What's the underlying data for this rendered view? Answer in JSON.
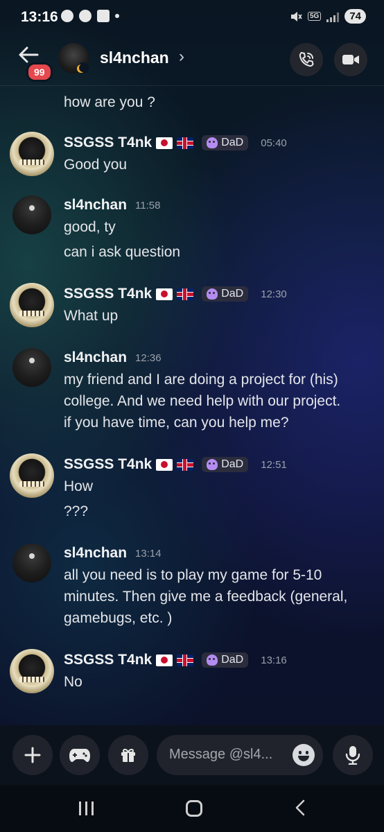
{
  "status_bar": {
    "time": "13:16",
    "network": "5G",
    "battery": "74"
  },
  "header": {
    "unread_count": "99",
    "channel_name": "sl4nchan",
    "chevron": "›"
  },
  "messages": [
    {
      "id": "m0",
      "author": null,
      "lines": [
        "how are you ?"
      ]
    },
    {
      "id": "m1",
      "author": "SSGSS T4nk",
      "tag": "DaD",
      "time": "05:40",
      "lines": [
        "Good you"
      ]
    },
    {
      "id": "m2",
      "author": "sl4nchan",
      "time": "11:58",
      "lines": [
        "good, ty",
        "can i ask question"
      ]
    },
    {
      "id": "m3",
      "author": "SSGSS T4nk",
      "tag": "DaD",
      "time": "12:30",
      "lines": [
        "What up"
      ]
    },
    {
      "id": "m4",
      "author": "sl4nchan",
      "time": "12:36",
      "lines": [
        "my friend and I are doing a project for (his)",
        "college. And we need help with our project.",
        "if you have time, can you help me?"
      ]
    },
    {
      "id": "m5",
      "author": "SSGSS T4nk",
      "tag": "DaD",
      "time": "12:51",
      "lines": [
        "How",
        "???"
      ]
    },
    {
      "id": "m6",
      "author": "sl4nchan",
      "time": "13:14",
      "lines": [
        "all you need is to play my game for 5-10",
        "minutes. Then give me a feedback (general,",
        "gamebugs, etc. )"
      ]
    },
    {
      "id": "m7",
      "author": "SSGSS T4nk",
      "tag": "DaD",
      "time": "13:16",
      "lines": [
        "No"
      ]
    }
  ],
  "composer": {
    "placeholder": "Message @sl4..."
  },
  "icons": {
    "back": "back-arrow-icon",
    "call": "phone-call-icon",
    "video": "video-camera-icon",
    "plus": "plus-icon",
    "games": "gamepad-icon",
    "gift": "gift-icon",
    "emoji": "emoji-icon",
    "mic": "microphone-icon"
  },
  "colors": {
    "unread_badge": "#e5484d",
    "tag_icon": "#b48cf0",
    "status_moon": "#f0b232"
  }
}
